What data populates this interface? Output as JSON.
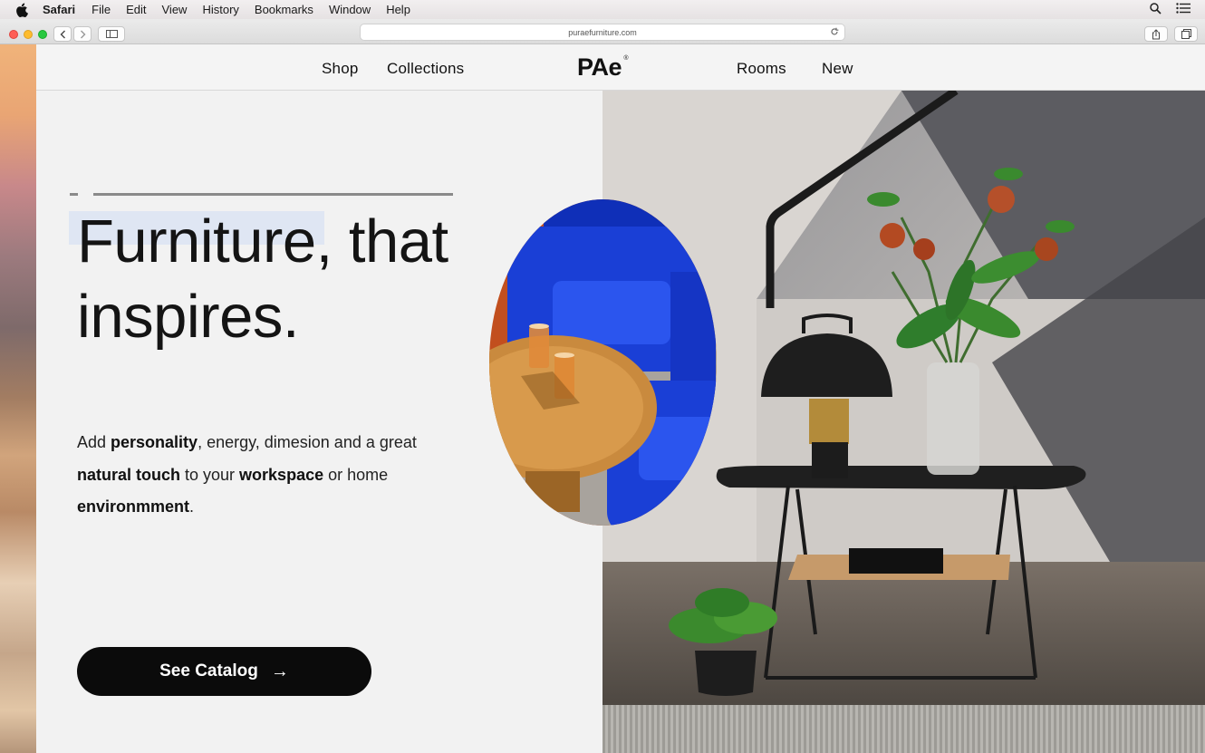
{
  "menubar": {
    "app": "Safari",
    "items": [
      "File",
      "Edit",
      "View",
      "History",
      "Bookmarks",
      "Window",
      "Help"
    ]
  },
  "browser": {
    "url": "puraefurniture.com"
  },
  "nav": {
    "links": [
      "Shop",
      "Collections",
      "Rooms",
      "New"
    ],
    "logo": "PAe",
    "logo_mark": "®"
  },
  "hero": {
    "headline_line1": "Furniture, that",
    "headline_line2": "inspires.",
    "body": {
      "p1": "Add ",
      "b1": "personality",
      "p2": ", energy, dimesion and a great ",
      "b2": "natural touch",
      "p3": " to your ",
      "b3": "workspace",
      "p4": " or home ",
      "b4": "environmment",
      "p5": "."
    },
    "cta_label": "See Catalog",
    "cta_arrow": "→"
  },
  "colors": {
    "page_bg": "#f2f2f2",
    "cta_bg": "#0b0b0b",
    "highlight": "#dfe6f3",
    "chair_blue": "#1a3fd6",
    "table_wood": "#c98a3e"
  }
}
